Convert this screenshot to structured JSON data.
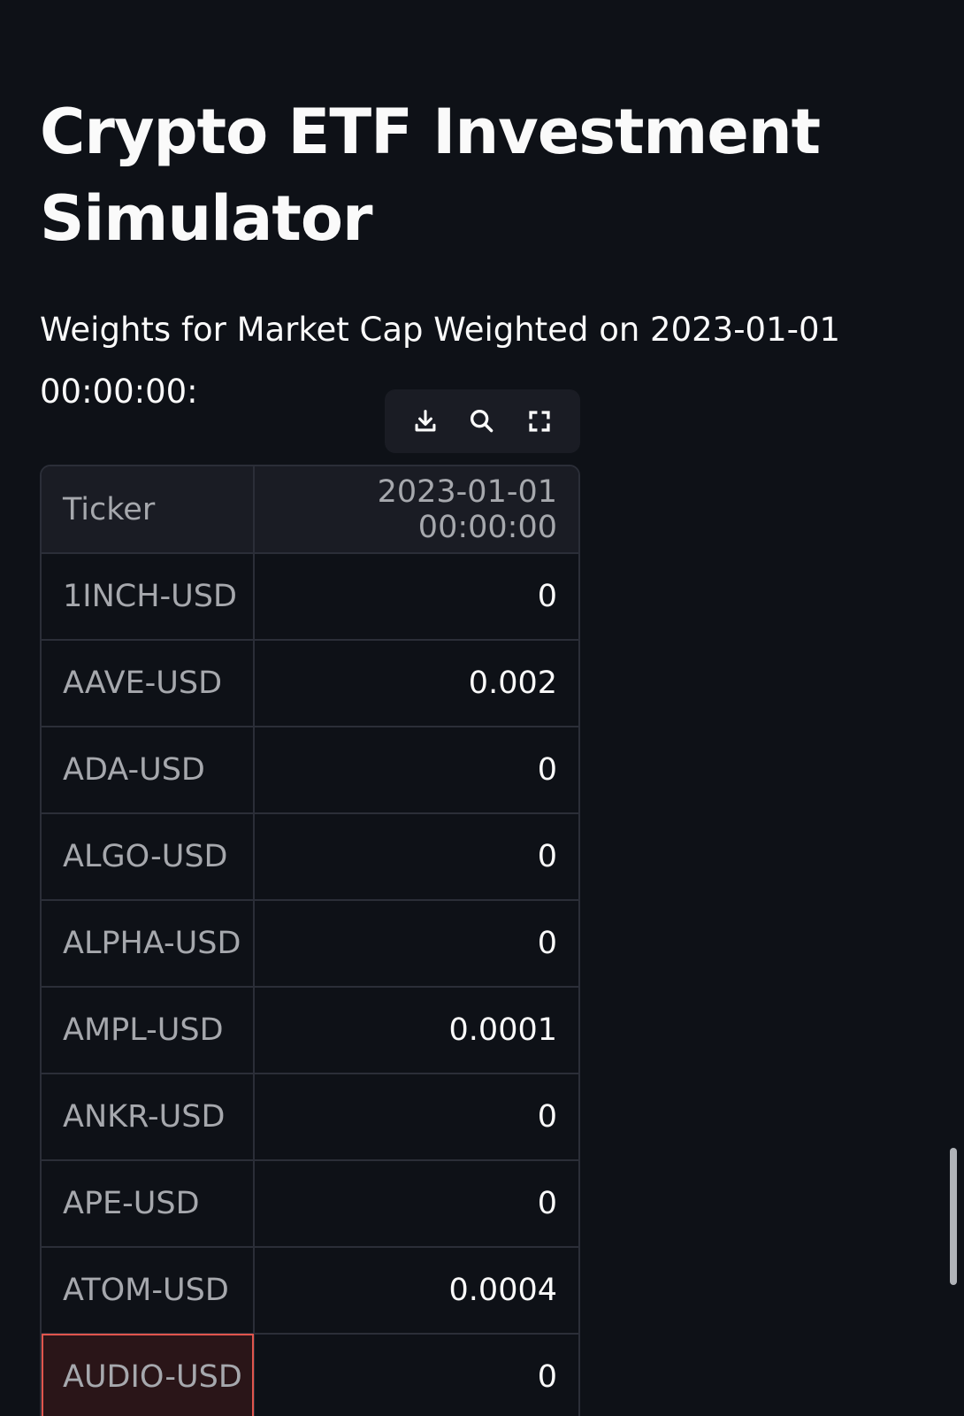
{
  "title": "Crypto ETF Investment Simulator",
  "subtitle": "Weights for Market Cap Weighted on 2023-01-01 00:00:00:",
  "toolbar": {
    "download_icon": "download-icon",
    "search_icon": "search-icon",
    "fullscreen_icon": "fullscreen-icon"
  },
  "table": {
    "headers": [
      "Ticker",
      "2023-01-01 00:00:00"
    ],
    "rows": [
      {
        "ticker": "1INCH-USD",
        "value": "0"
      },
      {
        "ticker": "AAVE-USD",
        "value": "0.002"
      },
      {
        "ticker": "ADA-USD",
        "value": "0"
      },
      {
        "ticker": "ALGO-USD",
        "value": "0"
      },
      {
        "ticker": "ALPHA-USD",
        "value": "0"
      },
      {
        "ticker": "AMPL-USD",
        "value": "0.0001"
      },
      {
        "ticker": "ANKR-USD",
        "value": "0"
      },
      {
        "ticker": "APE-USD",
        "value": "0"
      },
      {
        "ticker": "ATOM-USD",
        "value": "0.0004"
      },
      {
        "ticker": "AUDIO-USD",
        "value": "0"
      }
    ]
  },
  "colors": {
    "background": "#0e1117",
    "header_bg": "#1a1c24",
    "border": "#2b2e38",
    "selection": "#e0554d"
  }
}
